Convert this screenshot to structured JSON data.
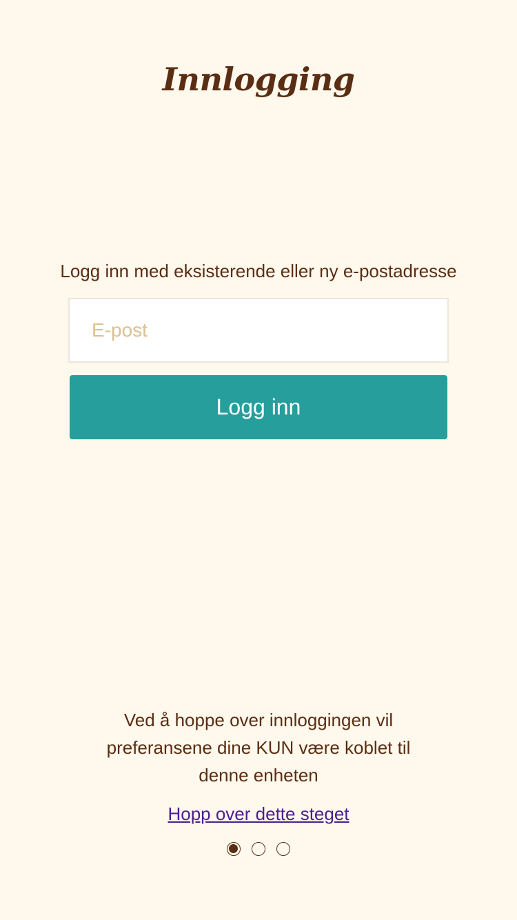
{
  "header": {
    "title": "Innlogging"
  },
  "login": {
    "prompt": "Logg inn med eksisterende eller ny e-postadresse",
    "email_placeholder": "E-post",
    "email_value": "",
    "button_label": "Logg inn"
  },
  "skip": {
    "info": "Ved å hoppe over innloggingen vil preferansene dine KUN være koblet til denne enheten",
    "link_label": "Hopp over dette steget"
  },
  "pagination": {
    "total": 3,
    "active_index": 0
  },
  "colors": {
    "background": "#fff8ec",
    "text": "#5a2e14",
    "accent": "#259e9c",
    "link": "#4b1f8e",
    "placeholder": "#dcc08f"
  }
}
